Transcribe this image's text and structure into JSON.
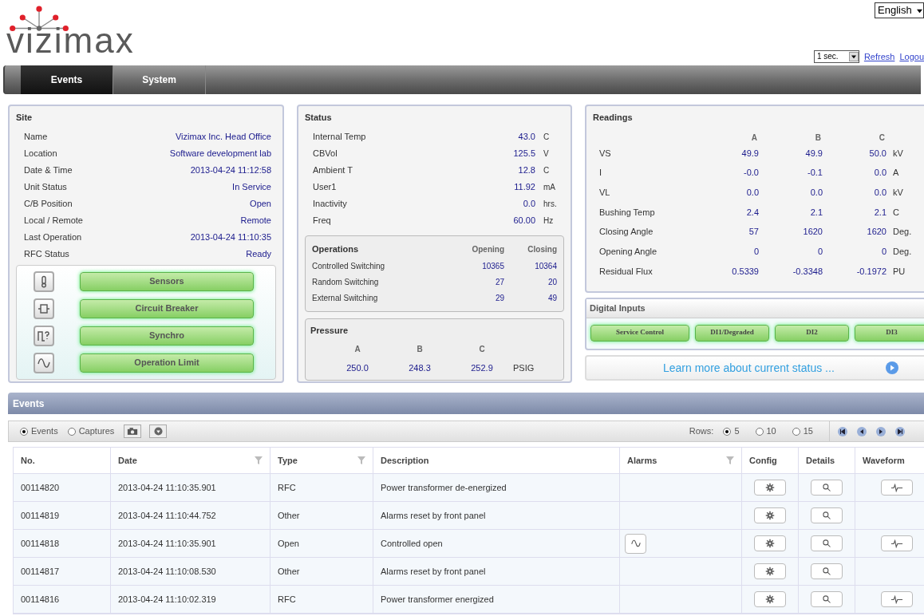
{
  "logo": {
    "text": "vizimax"
  },
  "language": {
    "value": "English"
  },
  "refresh_interval": {
    "value": "1 sec."
  },
  "header_links": [
    "Refresh",
    "Logou"
  ],
  "nav_tabs": [
    {
      "label": "Events",
      "selected": true
    },
    {
      "label": "System",
      "selected": false
    }
  ],
  "site": {
    "title": "Site",
    "rows": [
      {
        "label": "Name",
        "value": "Vizimax Inc. Head Office"
      },
      {
        "label": "Location",
        "value": "Software development lab"
      },
      {
        "label": "Date & Time",
        "value": "2013-04-24 11:12:58"
      },
      {
        "label": "Unit Status",
        "value": "In Service"
      },
      {
        "label": "C/B Position",
        "value": "Open"
      },
      {
        "label": "Local / Remote",
        "value": "Remote"
      },
      {
        "label": "Last Operation",
        "value": "2013-04-24 11:10:35"
      },
      {
        "label": "RFC Status",
        "value": "Ready"
      }
    ],
    "buttons": [
      {
        "label": "Sensors",
        "kind": "thermometer"
      },
      {
        "label": "Circuit Breaker",
        "kind": "breaker"
      },
      {
        "label": "Synchro",
        "kind": "synchro"
      },
      {
        "label": "Operation Limit",
        "kind": "wave"
      }
    ]
  },
  "status": {
    "title": "Status",
    "rows": [
      {
        "label": "Internal Temp",
        "value": "43.0",
        "unit": "C"
      },
      {
        "label": "CBVol",
        "value": "125.5",
        "unit": "V"
      },
      {
        "label": "Ambient T",
        "value": "12.8",
        "unit": "C"
      },
      {
        "label": "User1",
        "value": "11.92",
        "unit": "mA"
      },
      {
        "label": "Inactivity",
        "value": "0.0",
        "unit": "hrs."
      },
      {
        "label": "Freq",
        "value": "60.00",
        "unit": "Hz"
      }
    ],
    "operations": {
      "title": "Operations",
      "columns": [
        "Opening",
        "Closing"
      ],
      "rows": [
        {
          "label": "Controlled Switching",
          "values": [
            "10365",
            "10364"
          ]
        },
        {
          "label": "Random Switching",
          "values": [
            "27",
            "20"
          ]
        },
        {
          "label": "External Switching",
          "values": [
            "29",
            "49"
          ]
        }
      ]
    },
    "pressure": {
      "title": "Pressure",
      "columns": [
        "A",
        "B",
        "C"
      ],
      "values": [
        "250.0",
        "248.3",
        "252.9"
      ],
      "unit": "PSIG"
    }
  },
  "readings": {
    "title": "Readings",
    "columns": [
      "A",
      "B",
      "C"
    ],
    "rows": [
      {
        "label": "VS",
        "values": [
          "49.9",
          "49.9",
          "50.0"
        ],
        "unit": "kV"
      },
      {
        "label": "I",
        "values": [
          "-0.0",
          "-0.1",
          "0.0"
        ],
        "unit": "A"
      },
      {
        "label": "VL",
        "values": [
          "0.0",
          "0.0",
          "0.0"
        ],
        "unit": "kV"
      },
      {
        "label": "Bushing Temp",
        "values": [
          "2.4",
          "2.1",
          "2.1"
        ],
        "unit": "C"
      },
      {
        "label": "Closing Angle",
        "values": [
          "57",
          "1620",
          "1620"
        ],
        "unit": "Deg."
      },
      {
        "label": "Opening Angle",
        "values": [
          "0",
          "0",
          "0"
        ],
        "unit": "Deg."
      },
      {
        "label": "Residual Flux",
        "values": [
          "0.5339",
          "-0.3348",
          "-0.1972"
        ],
        "unit": "PU"
      }
    ]
  },
  "digital_inputs": {
    "title": "Digital Inputs",
    "items": [
      "Service Control",
      "DI1/Degraded",
      "DI2",
      "DI3"
    ]
  },
  "learn_more": "Learn more about current status ...",
  "events": {
    "title": "Events",
    "view": [
      {
        "label": "Events",
        "selected": true
      },
      {
        "label": "Captures",
        "selected": false
      }
    ],
    "rows_label": "Rows:",
    "rows_options": [
      {
        "label": "5",
        "selected": true
      },
      {
        "label": "10",
        "selected": false
      },
      {
        "label": "15",
        "selected": false
      }
    ],
    "columns": [
      {
        "label": "No.",
        "filter": false
      },
      {
        "label": "Date",
        "filter": true
      },
      {
        "label": "Type",
        "filter": true
      },
      {
        "label": "Description",
        "filter": false
      },
      {
        "label": "Alarms",
        "filter": true
      },
      {
        "label": "Config",
        "filter": false
      },
      {
        "label": "Details",
        "filter": false
      },
      {
        "label": "Waveform",
        "filter": false
      }
    ],
    "rows": [
      {
        "no": "00114820",
        "date": "2013-04-24 11:10:35.901",
        "type": "RFC",
        "description": "Power transformer de-energized",
        "alarm": false,
        "waveform": true
      },
      {
        "no": "00114819",
        "date": "2013-04-24 11:10:44.752",
        "type": "Other",
        "description": "Alarms reset by front panel",
        "alarm": false,
        "waveform": false
      },
      {
        "no": "00114818",
        "date": "2013-04-24 11:10:35.901",
        "type": "Open",
        "description": "Controlled open",
        "alarm": true,
        "waveform": true
      },
      {
        "no": "00114817",
        "date": "2013-04-24 11:10:08.530",
        "type": "Other",
        "description": "Alarms reset by front panel",
        "alarm": false,
        "waveform": false
      },
      {
        "no": "00114816",
        "date": "2013-04-24 11:10:02.319",
        "type": "RFC",
        "description": "Power transformer energized",
        "alarm": false,
        "waveform": true
      }
    ]
  }
}
